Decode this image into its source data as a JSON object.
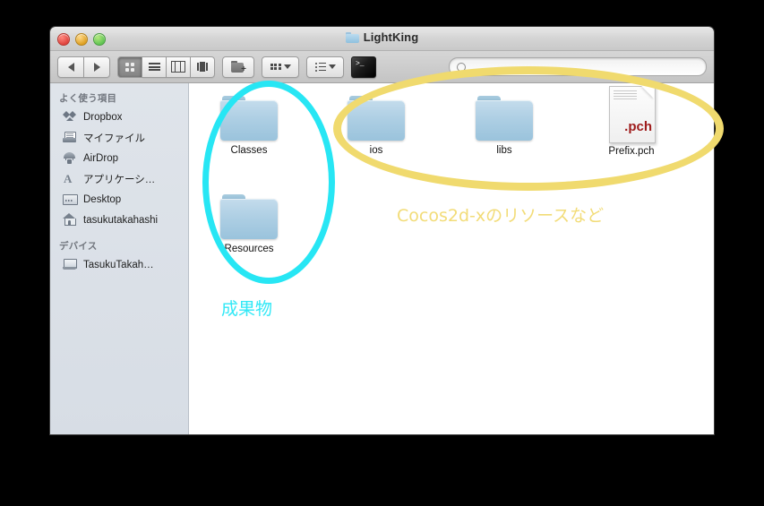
{
  "window": {
    "title": "LightKing",
    "title_icon": "folder-icon",
    "controls": {
      "close": "close-button",
      "minimize": "minimize-button",
      "maximize": "maximize-button"
    }
  },
  "toolbar": {
    "back_label": "◀",
    "forward_label": "▶",
    "view_modes": [
      {
        "name": "icon-view",
        "selected": true
      },
      {
        "name": "list-view",
        "selected": false
      },
      {
        "name": "column-view",
        "selected": false
      },
      {
        "name": "coverflow-view",
        "selected": false
      }
    ],
    "new_folder": "new-folder-button",
    "arrange": "arrange-dropdown",
    "action": "action-dropdown",
    "terminal": "terminal-button",
    "terminal_prompt": ">_"
  },
  "search": {
    "value": "",
    "placeholder": ""
  },
  "sidebar": {
    "sections": [
      {
        "header": "よく使う項目",
        "items": [
          {
            "label": "Dropbox",
            "icon": "dropbox-icon"
          },
          {
            "label": "マイファイル",
            "icon": "my-files-icon"
          },
          {
            "label": "AirDrop",
            "icon": "airdrop-icon"
          },
          {
            "label": "アプリケーシ…",
            "icon": "applications-icon"
          },
          {
            "label": "Desktop",
            "icon": "desktop-icon"
          },
          {
            "label": "tasukutakahashi",
            "icon": "home-icon"
          }
        ]
      },
      {
        "header": "デバイス",
        "items": [
          {
            "label": "TasukuTakah…",
            "icon": "laptop-icon"
          }
        ]
      }
    ]
  },
  "content": {
    "files": [
      {
        "name": "Classes",
        "type": "folder"
      },
      {
        "name": "Resources",
        "type": "folder"
      },
      {
        "name": "ios",
        "type": "folder"
      },
      {
        "name": "libs",
        "type": "folder"
      },
      {
        "name": "Prefix.pch",
        "type": "document",
        "extension": ".pch"
      }
    ]
  },
  "annotations": {
    "cyan": {
      "text": "成果物",
      "color": "#31e8f6"
    },
    "yellow": {
      "text": "Cocos2d-xのリソースなど",
      "color": "#f2dc78"
    }
  },
  "colors": {
    "cyan_highlight": "#27e6f4",
    "yellow_highlight": "#f0da6e",
    "sidebar_bg": "#dfe4ea",
    "content_bg": "#ffffff",
    "folder_blue": "#aecfe4",
    "pch_red": "#9e1b1b"
  }
}
